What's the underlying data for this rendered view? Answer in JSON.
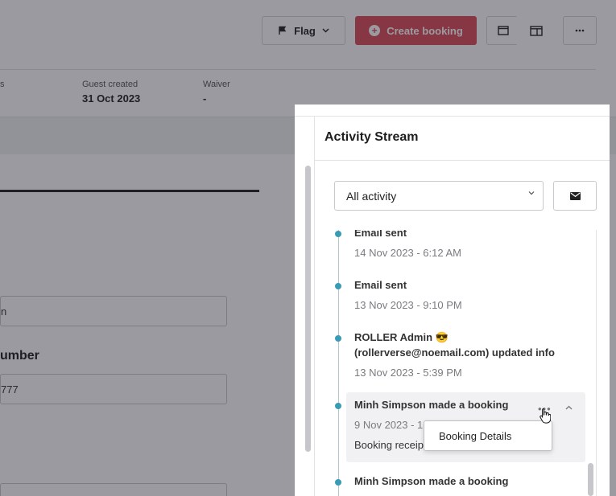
{
  "toolbar": {
    "flag_label": "Flag",
    "create_booking_label": "Create booking"
  },
  "info": {
    "partial_label": "s",
    "guest_created_label": "Guest created",
    "guest_created_value": "31 Oct 2023",
    "waiver_label": "Waiver",
    "waiver_value": "-"
  },
  "form": {
    "field1_value": "n",
    "field2_label": "umber",
    "field2_value": "777"
  },
  "activity": {
    "title": "Activity Stream",
    "filter_selected": "All activity",
    "items": [
      {
        "title": "Email sent",
        "date": "14 Nov 2023 - 6:12 AM"
      },
      {
        "title": "Email sent",
        "date": "13 Nov 2023 - 9:10 PM"
      },
      {
        "title": "ROLLER Admin 😎 (rollerverse@noemail.com) updated info",
        "date": "13 Nov 2023 - 5:39 PM"
      },
      {
        "title": "Minh Simpson made a booking",
        "date": "9 Nov 2023 - 1:",
        "desc": "Booking receip"
      },
      {
        "title": "Minh Simpson made a booking"
      }
    ],
    "more_icon": "•••",
    "popup_item": "Booking Details"
  },
  "colors": {
    "accent": "#dc4c56",
    "timeline_dot": "#3a9bb4"
  }
}
